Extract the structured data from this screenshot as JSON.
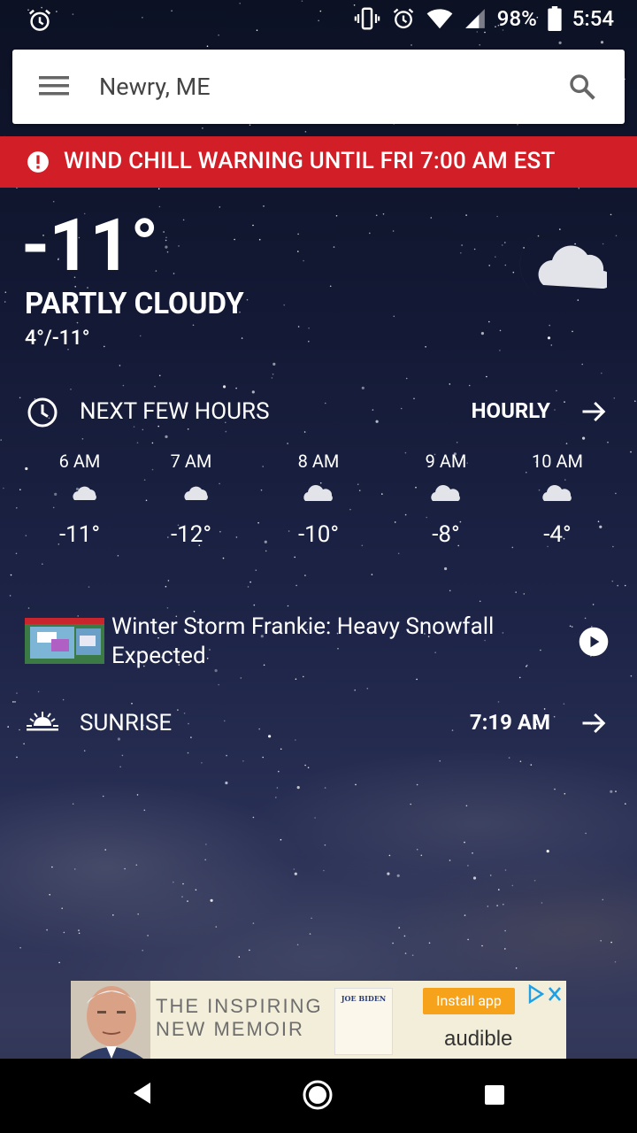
{
  "status_bar": {
    "battery": "98%",
    "time": "5:54"
  },
  "search": {
    "location": "Newry, ME"
  },
  "alert": {
    "text": "WIND CHILL WARNING UNTIL FRI 7:00 AM EST",
    "color": "#d21f27"
  },
  "current": {
    "temperature": "-11°",
    "condition": "PARTLY CLOUDY",
    "hi_lo": "4°/-11°",
    "icon": "moon-cloud-icon"
  },
  "hourly_section": {
    "title": "NEXT FEW HOURS",
    "link_label": "HOURLY",
    "hours": [
      {
        "time": "6 AM",
        "icon": "moon-cloud-icon",
        "temp": "-11°"
      },
      {
        "time": "7 AM",
        "icon": "moon-cloud-icon",
        "temp": "-12°"
      },
      {
        "time": "8 AM",
        "icon": "cloud-icon",
        "temp": "-10°"
      },
      {
        "time": "9 AM",
        "icon": "cloud-icon",
        "temp": "-8°"
      },
      {
        "time": "10 AM",
        "icon": "cloud-icon",
        "temp": "-4°"
      }
    ]
  },
  "news": {
    "title": "Winter Storm Frankie: Heavy Snowfall Expected"
  },
  "sunrise": {
    "label": "SUNRISE",
    "time": "7:19 AM"
  },
  "ad": {
    "headline_line1": "THE INSPIRING",
    "headline_line2": "NEW MEMOIR",
    "book_title": "JOE BIDEN",
    "install_label": "Install app",
    "brand": "audible"
  }
}
